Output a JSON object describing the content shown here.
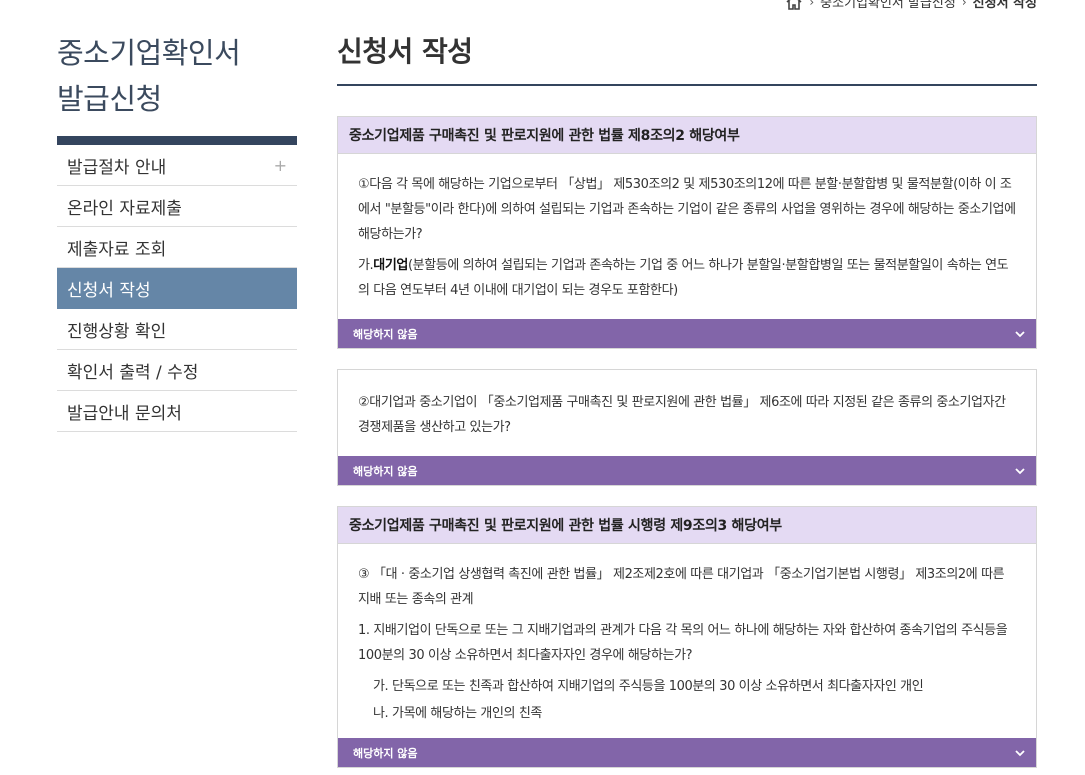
{
  "breadcrumb": {
    "items": [
      "중소기업확인서 발급신청",
      "신청서 작성"
    ]
  },
  "sidebar": {
    "title_line1": "중소기업확인서",
    "title_line2": "발급신청",
    "items": [
      {
        "label": "발급절차 안내",
        "expand": "+"
      },
      {
        "label": "온라인 자료제출"
      },
      {
        "label": "제출자료 조회"
      },
      {
        "label": "신청서 작성"
      },
      {
        "label": "진행상황 확인"
      },
      {
        "label": "확인서 출력 / 수정"
      },
      {
        "label": "발급안내 문의처"
      }
    ]
  },
  "main": {
    "title": "신청서 작성",
    "section1": {
      "header": "중소기업제품 구매촉진 및 판로지원에 관한 법률 제8조의2 해당여부",
      "q1": "①다음 각 목에 해당하는 기업으로부터 「상법」 제530조의2 및 제530조의12에 따른 분할·분할합병 및 물적분할(이하 이 조에서 \"분할등\"이라 한다)에 의하여 설립되는 기업과 존속하는 기업이 같은 종류의 사업을 영위하는 경우에 해당하는 중소기업에 해당하는가?",
      "q1a_prefix": "가.",
      "q1a_bold": "대기업",
      "q1a_rest": "(분할등에 의하여 설립되는 기업과 존속하는 기업 중 어느 하나가 분할일·분할합병일 또는 물적분할일이 속하는 연도의 다음 연도부터 4년 이내에 대기업이 되는 경우도 포함한다)",
      "answer": "해당하지 않음"
    },
    "section2": {
      "q2": "②대기업과 중소기업이 「중소기업제품 구매촉진 및 판로지원에 관한 법률」 제6조에 따라 지정된 같은 종류의 중소기업자간 경쟁제품을 생산하고 있는가?",
      "answer": "해당하지 않음"
    },
    "section3": {
      "header": "중소기업제품 구매촉진 및 판로지원에 관한 법률 시행령 제9조의3 해당여부",
      "q3": "③ 「대 · 중소기업 상생협력 촉진에 관한 법률」 제2조제2호에 따른 대기업과 「중소기업기본법 시행령」 제3조의2에 따른 지배 또는 종속의 관계",
      "item1": "1. 지배기업이 단독으로 또는 그 지배기업과의 관계가 다음 각 목의 어느 하나에 해당하는 자와 합산하여 종속기업의 주식등을 100분의 30 이상 소유하면서 최다출자자인 경우에 해당하는가?",
      "item1a": "가. 단독으로 또는 친족과 합산하여 지배기업의 주식등을 100분의 30 이상 소유하면서 최다출자자인 개인",
      "item1b": "나. 가목에 해당하는 개인의 친족",
      "answer": "해당하지 않음"
    }
  }
}
